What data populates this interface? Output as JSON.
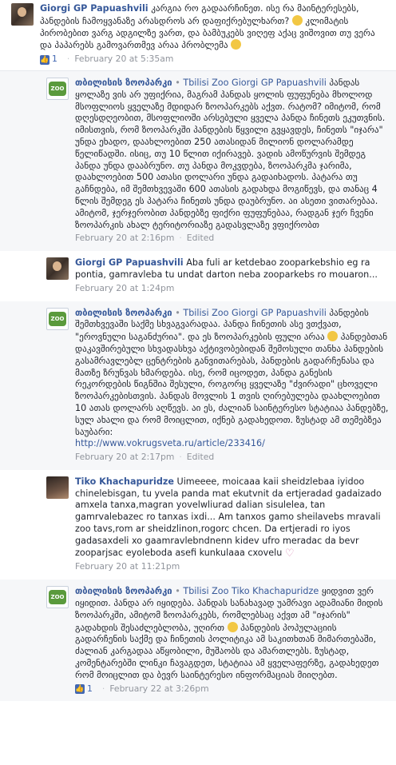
{
  "comments": [
    {
      "author": "Giorgi GP Papuashvili",
      "text": "კარგია რო გადაარჩინეთ. ისე რა მაინტერესებს, პანდების ჩამოყვანაზე არასდროს არ დაფიქრებულხართ? [emoji] კლიმატის პირობებით ვარგ ადგილზე ვართ, და ბამბუკებს ვიღეფ აქაც ვიშოვით თუ ვერა და პაპარებს გამოვართმევ არაა პრობლემა [emoji]",
      "likes": "1",
      "timestamp": "February 20 at 5:35am"
    },
    {
      "author": "თბილისის ზოოპარკი",
      "via": "Tbilisi Zoo",
      "tagged": "Giorgi GP Papuashvili",
      "text": "პანდას ყოლაზე ვის არ უფიქრია, მაგრამ პანდას ყოლის ფუფუნება მხოლოდ მსოფლიოს ყველაზე მდიდარ ზოოპარკებს აქვთ. რატომ? იმიტომ, რომ დღესდღეობით, მსოფლიოში არსებული ყველა პანდა ჩინეთს ეკუთვნის. იმისთვის, რომ ზოოპარკში პანდების წყვილი გვყავდეს, ჩინეთს \"იჯარა\" უნდა ეხადო, დაახლოებით 250 ათასიდან მილიონ დოლარამდე წელიწადში. ისიც, თუ 10 წლით იქირავებ. ვადის ამოწურვის შემდეგ პანდა უნდა დააბრუნო. თუ პანდა მოკვდება, ზოოპარკმა ჯარიმა, დაახლოებით 500 ათასი დოლარი უნდა გადაიხადოს. პატარა თუ გაჩნდება, იმ შემთხვევაში 600 ათასის გადახდა მოგიწევს, და თანაც 4 წლის შემდეგ ეს პატარა ჩინეთს უნდა დაუბრუნო. აი ასეთი ვითარებაა. ამიტომ, ჯერჯერობით პანდებზე ფიქრი ფუფუნებაა, რადგან ჯერ ჩვენი ზოოპარკის ახალ ტერიტორიაზე გადასვლაზე ვფიქრობთ",
      "timestamp": "February 20 at 2:16pm",
      "edited": "Edited"
    },
    {
      "author": "Giorgi GP Papuashvili",
      "text": "Aba fuli ar ketdebao zooparkebshio eg ra pontia, gamravleba tu undat darton neba zooparkebs ro mouaron...",
      "timestamp": "February 20 at 1:24pm"
    },
    {
      "author": "თბილისის ზოოპარკი",
      "via": "Tbilisi Zoo",
      "tagged": "Giorgi GP Papuashvili",
      "text": "პანდების შემთხვევაში საქმე სხვაგვარადაა. პანდა ჩინეთის ასე ვთქვათ, \"ეროვნული საგანძურია\". და ეს ზოოპარკების ფული არაა [emoji] პანდებთან დაკავშირებული სხვადასხვა აქტივობებიდან შემოსული თანხა პანდების გასამრავლებლ ცენტრების განვითარებას, პანდების გადარჩენასა და მათზე ზრუნვას ხმარდება. ისე, რომ იცოდეთ, პანდა განესის რეკორდების წიგნშია შესული, როგორც ყველაზე \"ძვირადი\" ცხოველი ზოოპარკებისთვის. პანდას მოვლის 1 თვის ღირებულება დაახლოებით 10 ათას დოლარს აღწევს. აი ეს, ძალიან საინტერესო სტატიაა პანდებზე, სულ ახალი და რომ მოიცლით, იქნებ გადახედოთ. ზუსტად ამ თემებზეა საუბარი:",
      "link": "http://www.vokrugsveta.ru/article/233416/",
      "timestamp": "February 20 at 2:17pm",
      "edited": "Edited"
    },
    {
      "author": "Tiko Khachapuridze",
      "text": "Uimeeee, moicaaa kaii sheidzlebaa iyidoo chinelebisgan, tu yvela panda mat ekutvnit da ertjeradad gadaizado amxela tanxa,magran yovelwliurad dalian sisulelea, tan gamrvalebazec ro tanxas ixdi... Am tanxos gamo sheilavebs mravali zoo tavs,rom ar sheidzlinon,rogorc chcen. Da ertjeradi ro iyos gadasaxdeli xo gaamravlebndnenn kidev ufro meradac da bevr zooparjsac eyoleboda asefi kunkulaaa cxovelu",
      "timestamp": "February 20 at 11:21pm"
    },
    {
      "author": "თბილისის ზოოპარკი",
      "via": "Tbilisi Zoo",
      "tagged": "Tiko Khachapuridze",
      "text": "ყიდვით ვერ იყიდით. პანდა არ იყიდება. პანდას სანახავად უამრავი ადამიანი მიდის ზოოპარკში, ამიტომ ზოოპარკებს, რომლებსაც აქვთ ამ \"იჯარის\" გადახდის შესაძლებლობა, უღირთ [emoji] პანდების პოპულაციის გადარჩენის საქმე და ჩინეთის პოლიტიკა ამ საკითხთან მიმართებაში, ძალიან კარგადაა აწყობილი, მუშაობს და ამართლებს. ზუსტად, კომენტარებში ლინკი ჩავაგდეთ, სტატიაა ამ ყველაფერზე, გადახედეთ რომ მოიცლით და ბევრ საინტერესო ინფორმაციას მიიღებთ.",
      "likes": "1",
      "timestamp": "February 22 at 3:26pm"
    }
  ]
}
